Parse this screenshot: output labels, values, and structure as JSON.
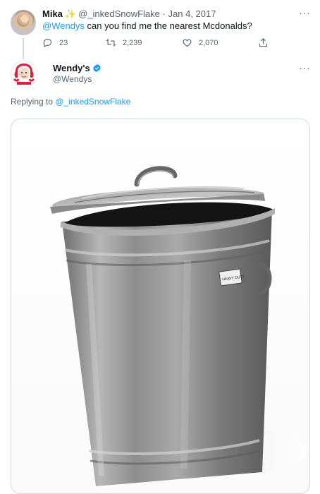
{
  "original_tweet": {
    "display_name": "Mika",
    "handle": "@_inkedSnowFlake",
    "separator": "·",
    "date": "Jan 4, 2017",
    "mention": "@Wendys",
    "text": " can you find me the nearest Mcdonalds?",
    "reply_count": "23",
    "retweet_count": "2,239",
    "like_count": "2,070",
    "more_label": "···"
  },
  "reply_tweet": {
    "display_name": "Wendy's",
    "handle": "@Wendys",
    "replying_prefix": "Replying to ",
    "replying_handle": "@_inkedSnowFlake",
    "more_label": "···",
    "media_alt": "photo of a metal trash can with lid",
    "trash_can_label": "HEAVY DUTY"
  },
  "colors": {
    "link": "#1d9bf0",
    "muted": "#536471",
    "verified": "#1d9bf0",
    "sparkle": "#f4b400"
  }
}
